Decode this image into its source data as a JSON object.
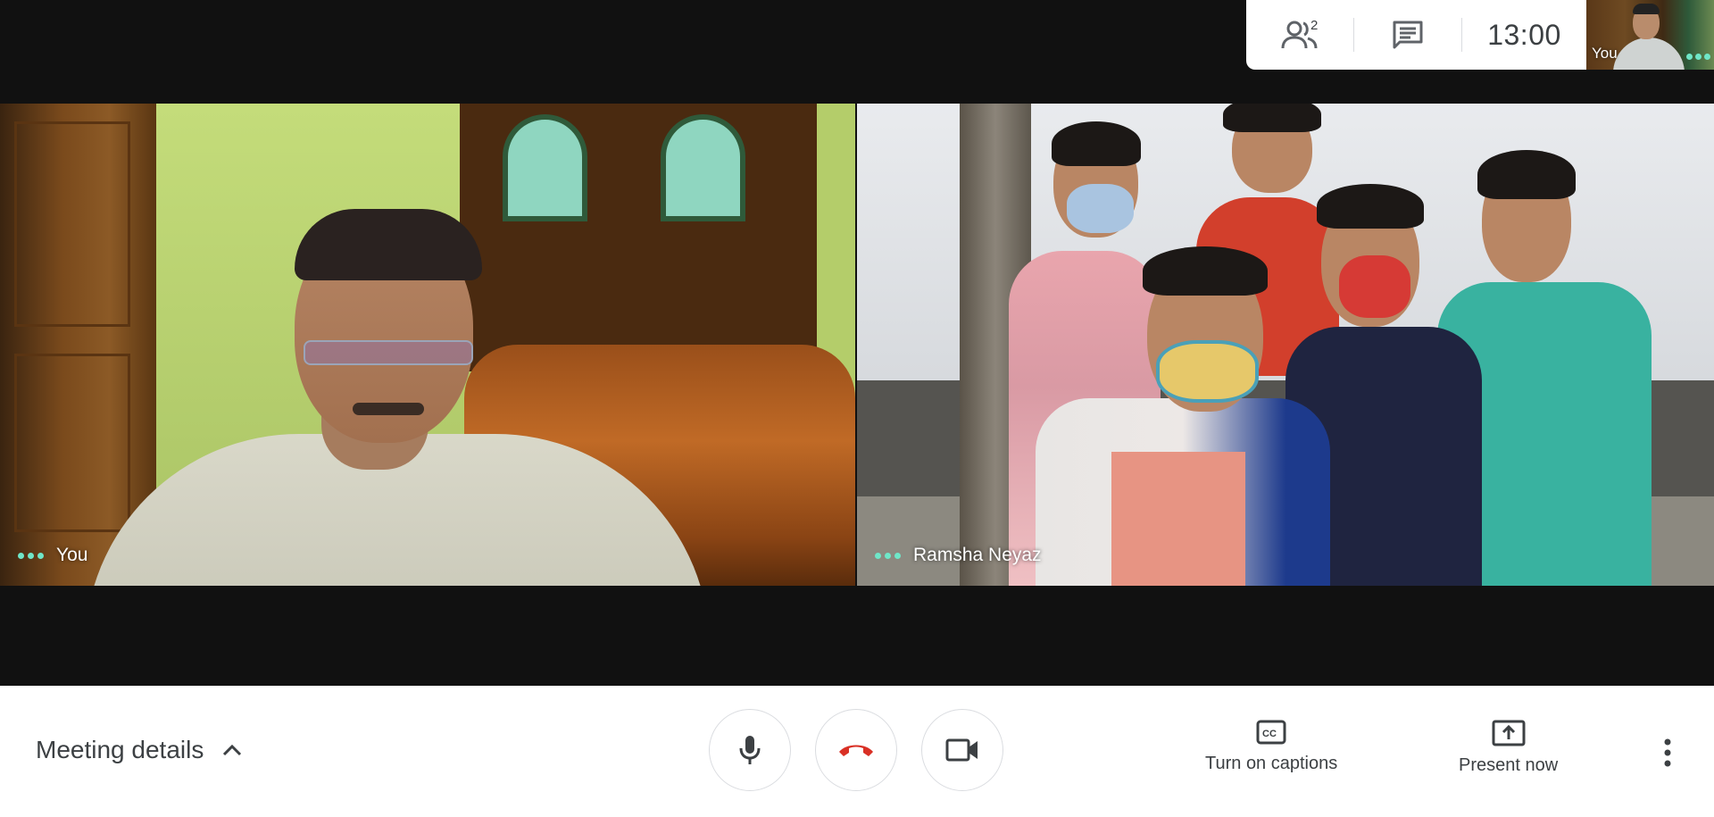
{
  "top_panel": {
    "participants_icon": "people-icon",
    "participant_count": "2",
    "chat_icon": "chat-icon",
    "time": "13:00"
  },
  "self_view": {
    "label": "You"
  },
  "tiles": [
    {
      "name": "You"
    },
    {
      "name": "Ramsha Neyaz"
    }
  ],
  "toolbar": {
    "meeting_details_label": "Meeting details",
    "meeting_details_icon": "chevron-up-icon",
    "mic_icon": "microphone-icon",
    "hangup_icon": "phone-hangup-icon",
    "camera_icon": "video-camera-icon",
    "captions_label": "Turn on captions",
    "captions_icon": "closed-captions-icon",
    "present_label": "Present now",
    "present_icon": "present-screen-icon",
    "more_icon": "more-vertical-icon"
  },
  "colors": {
    "hangup_red": "#d93025",
    "accent_dots": "#6fe6c8",
    "text_dark": "#3c4043",
    "stage_bg": "#111111"
  }
}
